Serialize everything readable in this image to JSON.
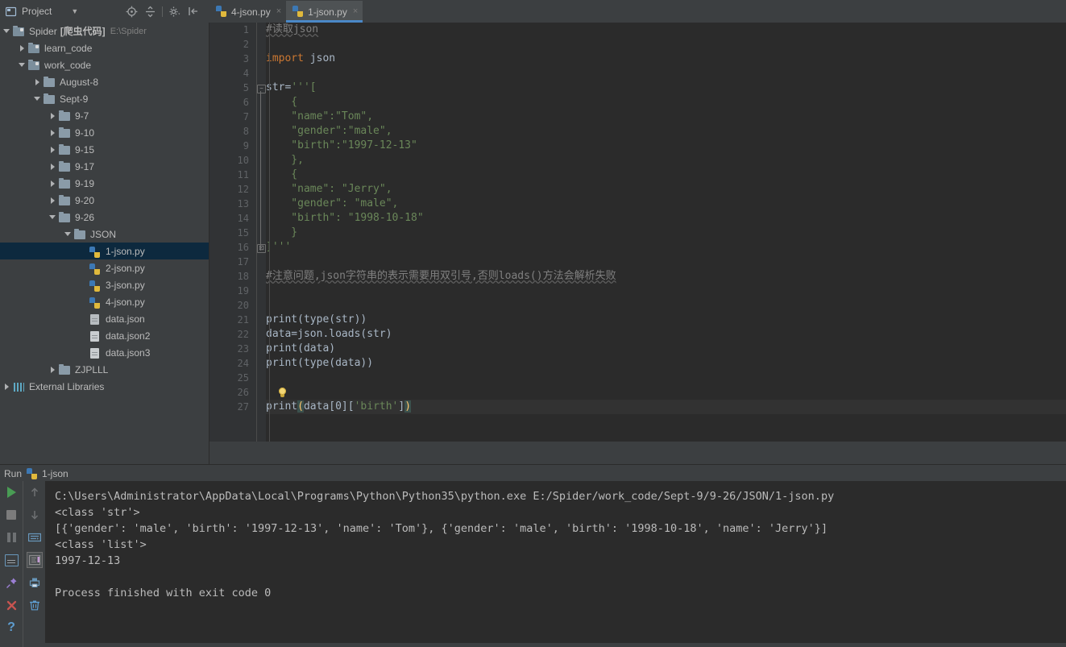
{
  "project_pane": {
    "title": "Project",
    "icons": [
      "project-icon",
      "chevron-down-icon",
      "locate-icon",
      "collapse-all-icon",
      "settings-gear-icon",
      "hide-panel-icon"
    ],
    "tree": [
      {
        "label": "Spider",
        "bracket": "[爬虫代码]",
        "path": "E:\\Spider",
        "icon": "folder-module",
        "arrow": "down",
        "indent": 0,
        "selected": false
      },
      {
        "label": "learn_code",
        "icon": "folder-module",
        "arrow": "right",
        "indent": 1,
        "selected": false
      },
      {
        "label": "work_code",
        "icon": "folder-module",
        "arrow": "down",
        "indent": 1,
        "selected": false
      },
      {
        "label": "August-8",
        "icon": "folder",
        "arrow": "right",
        "indent": 2,
        "selected": false
      },
      {
        "label": "Sept-9",
        "icon": "folder",
        "arrow": "down",
        "indent": 2,
        "selected": false
      },
      {
        "label": "9-7",
        "icon": "folder",
        "arrow": "right",
        "indent": 3,
        "selected": false
      },
      {
        "label": "9-10",
        "icon": "folder",
        "arrow": "right",
        "indent": 3,
        "selected": false
      },
      {
        "label": "9-15",
        "icon": "folder",
        "arrow": "right",
        "indent": 3,
        "selected": false
      },
      {
        "label": "9-17",
        "icon": "folder",
        "arrow": "right",
        "indent": 3,
        "selected": false
      },
      {
        "label": "9-19",
        "icon": "folder",
        "arrow": "right",
        "indent": 3,
        "selected": false
      },
      {
        "label": "9-20",
        "icon": "folder",
        "arrow": "right",
        "indent": 3,
        "selected": false
      },
      {
        "label": "9-26",
        "icon": "folder",
        "arrow": "down",
        "indent": 3,
        "selected": false
      },
      {
        "label": "JSON",
        "icon": "folder",
        "arrow": "down",
        "indent": 4,
        "selected": false
      },
      {
        "label": "1-json.py",
        "icon": "python-file",
        "arrow": "none",
        "indent": 5,
        "selected": true
      },
      {
        "label": "2-json.py",
        "icon": "python-file",
        "arrow": "none",
        "indent": 5,
        "selected": false
      },
      {
        "label": "3-json.py",
        "icon": "python-file",
        "arrow": "none",
        "indent": 5,
        "selected": false
      },
      {
        "label": "4-json.py",
        "icon": "python-file",
        "arrow": "none",
        "indent": 5,
        "selected": false
      },
      {
        "label": "data.json",
        "icon": "json-file-special",
        "arrow": "none",
        "indent": 5,
        "selected": false
      },
      {
        "label": "data.json2",
        "icon": "json-file",
        "arrow": "none",
        "indent": 5,
        "selected": false
      },
      {
        "label": "data.json3",
        "icon": "json-file",
        "arrow": "none",
        "indent": 5,
        "selected": false
      },
      {
        "label": "ZJPLLL",
        "icon": "folder",
        "arrow": "right",
        "indent": 3,
        "selected": false
      },
      {
        "label": "External Libraries",
        "icon": "library",
        "arrow": "right",
        "indent": 0,
        "selected": false
      }
    ]
  },
  "tabs": [
    {
      "label": "4-json.py",
      "active": false,
      "close": "×"
    },
    {
      "label": "1-json.py",
      "active": true,
      "close": "×"
    }
  ],
  "editor": {
    "current_line": 27,
    "lines": [
      {
        "n": 1,
        "segments": [
          {
            "t": "#读取json",
            "c": "cmt"
          }
        ]
      },
      {
        "n": 2,
        "segments": []
      },
      {
        "n": 3,
        "segments": [
          {
            "t": "import",
            "c": "kw"
          },
          {
            "t": " json",
            "c": "fn"
          }
        ]
      },
      {
        "n": 4,
        "segments": []
      },
      {
        "n": 5,
        "segments": [
          {
            "t": "str",
            "c": "fn"
          },
          {
            "t": "=",
            "c": "fn"
          },
          {
            "t": "'''[",
            "c": "str"
          }
        ],
        "fold": "open"
      },
      {
        "n": 6,
        "segments": [
          {
            "t": "    {",
            "c": "str"
          }
        ]
      },
      {
        "n": 7,
        "segments": [
          {
            "t": "    \"name\":\"Tom\",",
            "c": "str"
          }
        ]
      },
      {
        "n": 8,
        "segments": [
          {
            "t": "    \"gender\":\"male\",",
            "c": "str"
          }
        ]
      },
      {
        "n": 9,
        "segments": [
          {
            "t": "    \"birth\":\"1997-12-13\"",
            "c": "str"
          }
        ]
      },
      {
        "n": 10,
        "segments": [
          {
            "t": "    },",
            "c": "str"
          }
        ]
      },
      {
        "n": 11,
        "segments": [
          {
            "t": "    {",
            "c": "str"
          }
        ]
      },
      {
        "n": 12,
        "segments": [
          {
            "t": "    \"name\": \"Jerry\",",
            "c": "str"
          }
        ]
      },
      {
        "n": 13,
        "segments": [
          {
            "t": "    \"gender\": \"male\",",
            "c": "str"
          }
        ]
      },
      {
        "n": 14,
        "segments": [
          {
            "t": "    \"birth\": \"1998-10-18\"",
            "c": "str"
          }
        ]
      },
      {
        "n": 15,
        "segments": [
          {
            "t": "    }",
            "c": "str"
          }
        ]
      },
      {
        "n": 16,
        "segments": [
          {
            "t": "]'''",
            "c": "str"
          }
        ],
        "fold": "close"
      },
      {
        "n": 17,
        "segments": []
      },
      {
        "n": 18,
        "segments": [
          {
            "t": "#注意问题,json字符串的表示需要用双引号,否则loads()方法会解析失败",
            "c": "cmt"
          }
        ]
      },
      {
        "n": 19,
        "segments": []
      },
      {
        "n": 20,
        "segments": []
      },
      {
        "n": 21,
        "segments": [
          {
            "t": "print(type(str))",
            "c": "fn"
          }
        ]
      },
      {
        "n": 22,
        "segments": [
          {
            "t": "data=json.loads(str)",
            "c": "fn"
          }
        ]
      },
      {
        "n": 23,
        "segments": [
          {
            "t": "print(data)",
            "c": "fn"
          }
        ]
      },
      {
        "n": 24,
        "segments": [
          {
            "t": "print(type(data))",
            "c": "fn"
          }
        ]
      },
      {
        "n": 25,
        "segments": []
      },
      {
        "n": 26,
        "segments": [],
        "bulb": true
      },
      {
        "n": 27,
        "segments": [
          {
            "t": "print",
            "c": "fn"
          },
          {
            "t": "(",
            "c": "paren-hl"
          },
          {
            "t": "data[0][",
            "c": "fn"
          },
          {
            "t": "'birth'",
            "c": "str"
          },
          {
            "t": "]",
            "c": "fn"
          },
          {
            "t": ")",
            "c": "paren-hl"
          }
        ]
      }
    ]
  },
  "run_panel": {
    "header_label": "Run",
    "config_name": "1-json",
    "left_buttons": [
      "run-icon",
      "stop-icon",
      "pause-icon",
      "console-icon",
      "pin-icon",
      "close-icon",
      "help-icon"
    ],
    "right_buttons": [
      "scroll-up-icon",
      "scroll-down-icon",
      "soft-wrap-icon",
      "scroll-to-end-icon",
      "print-icon",
      "clear-all-icon"
    ],
    "console_lines": [
      "C:\\Users\\Administrator\\AppData\\Local\\Programs\\Python\\Python35\\python.exe E:/Spider/work_code/Sept-9/9-26/JSON/1-json.py",
      "<class 'str'>",
      "[{'gender': 'male', 'birth': '1997-12-13', 'name': 'Tom'}, {'gender': 'male', 'birth': '1998-10-18', 'name': 'Jerry'}]",
      "<class 'list'>",
      "1997-12-13",
      "",
      "Process finished with exit code 0"
    ]
  },
  "colors": {
    "panel_bg": "#3C3F41",
    "editor_bg": "#2B2B2B",
    "gutter_bg": "#313335",
    "selection_bg": "#0D293E",
    "tab_active_bg": "#4E5254",
    "tab_underline": "#4A88C7",
    "keyword": "#CC7832",
    "string": "#6A8759",
    "comment": "#808080",
    "text": "#A9B7C6"
  }
}
